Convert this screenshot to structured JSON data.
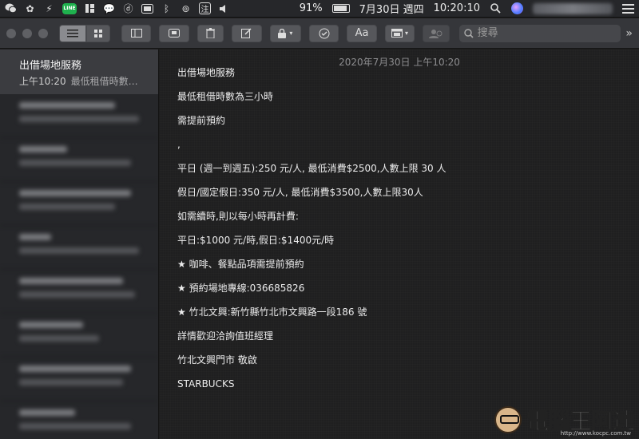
{
  "menubar": {
    "line_label": "LINE",
    "input_method": "注",
    "battery_percent": "91%",
    "date": "7月30日 週四",
    "time": "10:20:10",
    "battery_level": 0.91
  },
  "toolbar": {
    "format_label": "Aa",
    "search_placeholder": "搜尋",
    "more_label": "»"
  },
  "sidebar": {
    "selected_note": {
      "title": "出借場地服務",
      "time": "上午10:20",
      "preview": "最低租借時數…"
    }
  },
  "editor": {
    "date": "2020年7月30日 上午10:20",
    "lines": [
      "出借場地服務",
      "最低租借時數為三小時",
      "需提前預約",
      ",",
      "平日 (週一到週五):250 元/人, 最低消費$2500,人數上限 30 人",
      "假日/國定假日:350 元/人, 最低消費$3500,人數上限30人",
      "如需續時,則以每小時再計費:",
      "平日:$1000 元/時,假日:$1400元/時",
      "★ 咖啡、餐點品項需提前預約",
      "★ 預約場地專線:036685826",
      "★ 竹北文興:新竹縣竹北市文興路一段186 號",
      "詳情歡迎洽詢值班經理",
      "竹北文興門市 敬啟",
      "STARBUCKS"
    ]
  },
  "watermark": {
    "name": "電腦王阿達",
    "url": "http://www.kocpc.com.tw"
  }
}
